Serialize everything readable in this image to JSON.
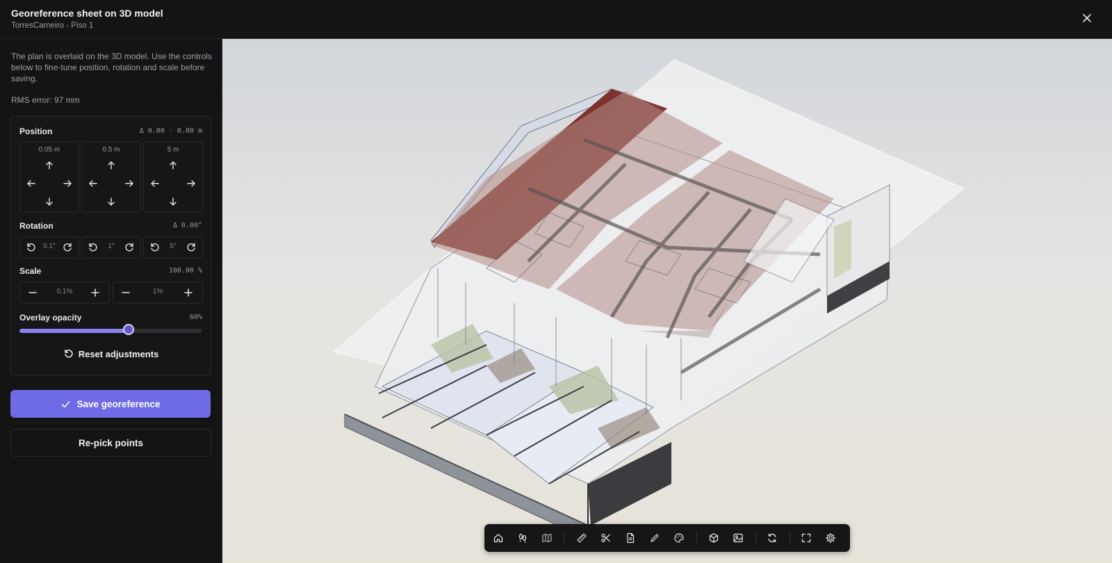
{
  "header": {
    "title": "Georeference sheet on 3D model",
    "subtitle": "TorresCarneiro - Piso 1",
    "close_icon": "close-icon"
  },
  "sidebar": {
    "intro": "The plan is overlaid on the 3D model. Use the controls below to fine-tune position, rotation and scale before saving.",
    "rms": "RMS error: 97 mm",
    "position": {
      "label": "Position",
      "delta": "Δ 0.00 · 0.00 m",
      "steps": [
        "0.05 m",
        "0.5 m",
        "5 m"
      ]
    },
    "rotation": {
      "label": "Rotation",
      "delta": "Δ 0.00°",
      "steps": [
        "0.1°",
        "1°",
        "5°"
      ]
    },
    "scale": {
      "label": "Scale",
      "value": "100.00 %",
      "steps": [
        "0.1%",
        "1%"
      ]
    },
    "opacity": {
      "label": "Overlay opacity",
      "value_text": "60%",
      "value": 0.6
    },
    "reset_label": "Reset adjustments",
    "save_label": "Save georeference",
    "repick_label": "Re-pick points"
  },
  "toolbar": {
    "tools": [
      "home-icon",
      "footprints-icon",
      "map-icon",
      "ruler-icon",
      "scissors-icon",
      "document-icon",
      "pencil-icon",
      "palette-icon",
      "cube-icon",
      "image-icon",
      "refresh-icon",
      "fullscreen-icon",
      "gear-icon"
    ]
  },
  "colors": {
    "accent": "#6f6ae6",
    "slider_fill": "#8b82ee",
    "background": "#141414"
  }
}
